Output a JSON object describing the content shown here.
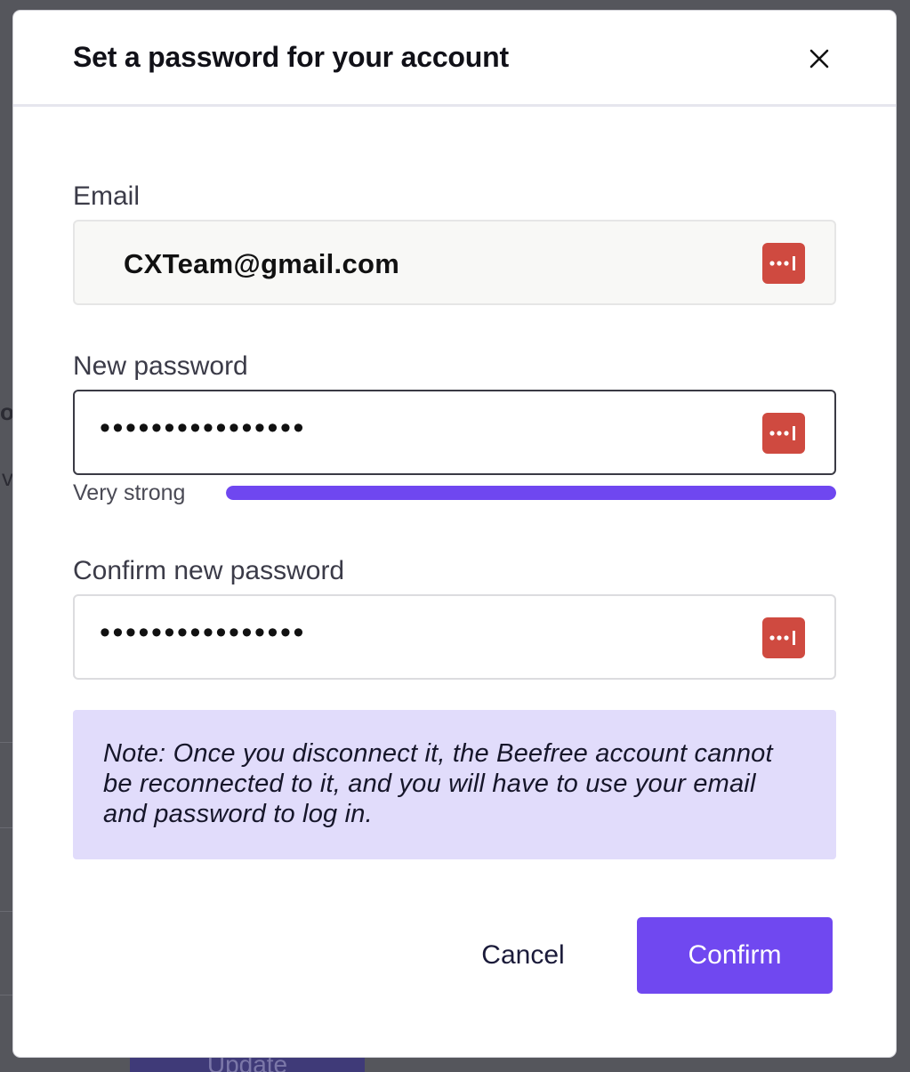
{
  "background": {
    "fragments": [
      "o",
      "v"
    ],
    "update_button_label": "Update"
  },
  "modal": {
    "title": "Set a password for your account",
    "close_icon": "close-icon"
  },
  "email": {
    "label": "Email",
    "value": "CXTeam@gmail.com",
    "icon": "password-manager-icon"
  },
  "new_password": {
    "label": "New password",
    "masked_value": "••••••••••••••••",
    "icon": "password-manager-icon",
    "strength_label": "Very strong",
    "strength_level": 1.0
  },
  "confirm_password": {
    "label": "Confirm new password",
    "masked_value": "••••••••••••••••",
    "icon": "password-manager-icon"
  },
  "note": {
    "text": "Note: Once you disconnect it, the Beefree account cannot be reconnected to it, and you will have to use your email and password to log in."
  },
  "actions": {
    "cancel_label": "Cancel",
    "confirm_label": "Confirm"
  },
  "colors": {
    "accent": "#7048f0",
    "note_bg": "#e1dcfb",
    "password_manager": "#cf4a40"
  }
}
